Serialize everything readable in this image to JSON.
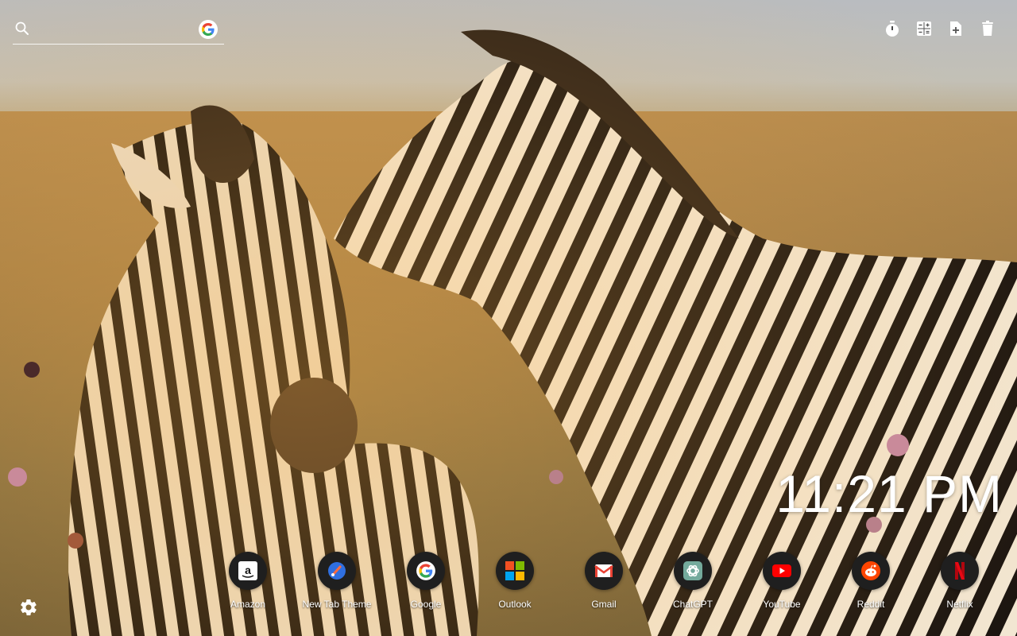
{
  "search": {
    "placeholder": "",
    "value": "",
    "engine_icon": "google-icon"
  },
  "tools": [
    {
      "name": "timer-icon"
    },
    {
      "name": "calculator-icon"
    },
    {
      "name": "add-note-icon"
    },
    {
      "name": "trash-icon"
    }
  ],
  "clock": {
    "time": "11:21 PM"
  },
  "shortcuts": [
    {
      "label": "Amazon",
      "icon": "amazon-icon"
    },
    {
      "label": "New Tab Theme",
      "icon": "new-tab-theme-icon"
    },
    {
      "label": "Google",
      "icon": "google-icon"
    },
    {
      "label": "Outlook",
      "icon": "outlook-icon"
    },
    {
      "label": "Gmail",
      "icon": "gmail-icon"
    },
    {
      "label": "ChatGPT",
      "icon": "chatgpt-icon"
    },
    {
      "label": "YouTube",
      "icon": "youtube-icon"
    },
    {
      "label": "Reddit",
      "icon": "reddit-icon"
    },
    {
      "label": "Netflix",
      "icon": "netflix-icon"
    }
  ],
  "settings": {
    "icon": "gear-icon"
  },
  "colors": {
    "google_blue": "#4285F4",
    "google_red": "#EA4335",
    "google_yellow": "#FBBC05",
    "google_green": "#34A853",
    "youtube_red": "#FF0000",
    "reddit_orange": "#FF4500",
    "netflix_red": "#E50914",
    "chatgpt_teal": "#74AA9C"
  }
}
